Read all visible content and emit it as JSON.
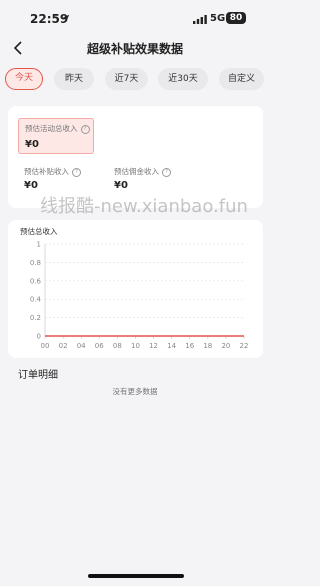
{
  "status_bar": {
    "time": "22:59",
    "network": "5G",
    "battery": "80"
  },
  "nav": {
    "title": "超级补贴效果数据"
  },
  "tabs": [
    {
      "label": "今天",
      "active": true
    },
    {
      "label": "昨天",
      "active": false
    },
    {
      "label": "近7天",
      "active": false
    },
    {
      "label": "近30天",
      "active": false
    },
    {
      "label": "自定义",
      "active": false
    }
  ],
  "metrics": {
    "total": {
      "label": "预估活动总收入",
      "value": "¥0"
    },
    "subsidy": {
      "label": "预估补贴收入",
      "value": "¥0"
    },
    "commission": {
      "label": "预估佣金收入",
      "value": "¥0"
    }
  },
  "watermark": "线报酷-new.xianbao.fun",
  "chart_data": {
    "type": "line",
    "title": "预估总收入",
    "x": [
      "00",
      "02",
      "04",
      "06",
      "08",
      "10",
      "12",
      "14",
      "16",
      "18",
      "20",
      "22"
    ],
    "series": [
      {
        "values": [
          0,
          0,
          0,
          0,
          0,
          0,
          0,
          0,
          0,
          0,
          0,
          0
        ]
      }
    ],
    "y_ticks": [
      "0",
      "0.2",
      "0.4",
      "0.6",
      "0.8",
      "1"
    ],
    "ylim": [
      0,
      1
    ],
    "grid": true,
    "line_color": "#e2574a"
  },
  "orders": {
    "title": "订单明细",
    "empty_text": "没有更多数据"
  },
  "colors": {
    "accent": "#e2574a",
    "background": "#f4f4f6"
  }
}
